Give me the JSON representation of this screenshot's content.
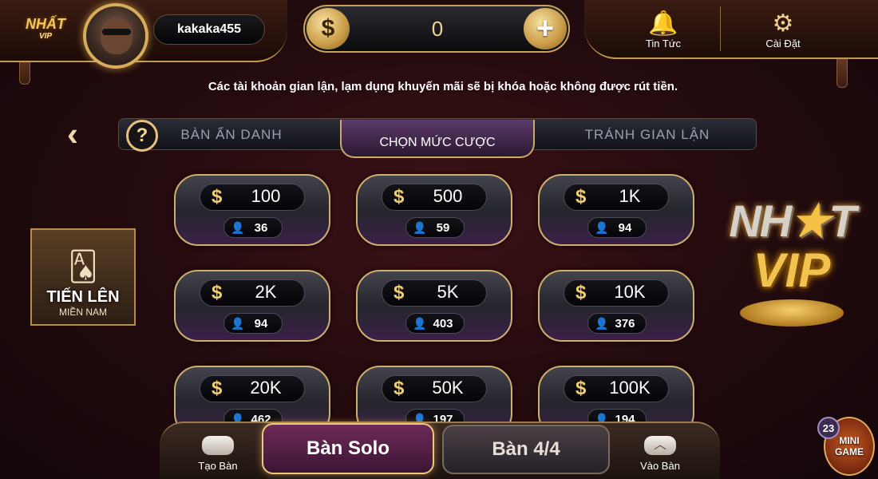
{
  "header": {
    "logo_line1": "NHẤT",
    "logo_line2": "VIP",
    "username": "kakaka455",
    "balance": "0",
    "currency_symbol": "$",
    "plus_symbol": "+",
    "news_label": "Tin Tức",
    "settings_label": "Cài Đặt"
  },
  "notice": "Các tài khoản gian lận, lạm dụng khuyến mãi sẽ bị khóa hoặc không được rút tiền.",
  "tabs": {
    "help_symbol": "?",
    "anonymous_table": "BÀN ẨN DANH",
    "choose_bet": "CHỌN MỨC CƯỢC",
    "avoid_fraud": "TRÁNH GIAN LẬN"
  },
  "bet_tiers": [
    {
      "amount": "100",
      "players": "36"
    },
    {
      "amount": "500",
      "players": "59"
    },
    {
      "amount": "1K",
      "players": "94"
    },
    {
      "amount": "2K",
      "players": "94"
    },
    {
      "amount": "5K",
      "players": "403"
    },
    {
      "amount": "10K",
      "players": "376"
    },
    {
      "amount": "20K",
      "players": "462"
    },
    {
      "amount": "50K",
      "players": "197"
    },
    {
      "amount": "100K",
      "players": "194"
    }
  ],
  "game_promo": {
    "title": "TIẾN LÊN",
    "subtitle": "MIỀN NAM"
  },
  "brand": {
    "line1_a": "NH",
    "line1_b": "T",
    "line2": "VIP"
  },
  "bottom_nav": {
    "create_table": "Tạo Bàn",
    "solo_table": "Bàn Solo",
    "four_table": "Bàn 4/4",
    "join_table": "Vào Bàn"
  },
  "mini_game": {
    "badge": "23",
    "line1": "MINI",
    "line2": "GAME"
  },
  "colors": {
    "accent_gold": "#d2ae6e",
    "background": "#250b0e",
    "active_tab": "#5d3a6c"
  }
}
